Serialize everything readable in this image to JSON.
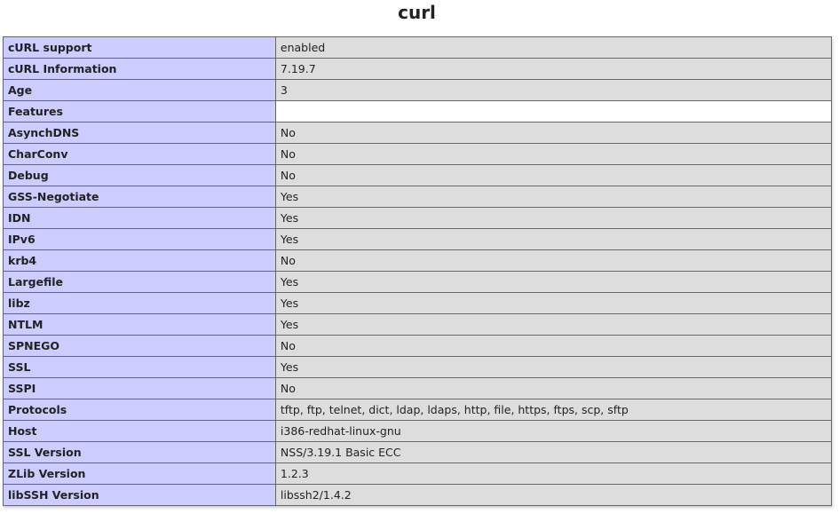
{
  "title": "curl",
  "rows": [
    {
      "key": "cURL support",
      "value": "enabled"
    },
    {
      "key": "cURL Information",
      "value": "7.19.7"
    },
    {
      "key": "Age",
      "value": "3"
    },
    {
      "key": "Features",
      "value": ""
    },
    {
      "key": "AsynchDNS",
      "value": "No"
    },
    {
      "key": "CharConv",
      "value": "No"
    },
    {
      "key": "Debug",
      "value": "No"
    },
    {
      "key": "GSS-Negotiate",
      "value": "Yes"
    },
    {
      "key": "IDN",
      "value": "Yes"
    },
    {
      "key": "IPv6",
      "value": "Yes"
    },
    {
      "key": "krb4",
      "value": "No"
    },
    {
      "key": "Largefile",
      "value": "Yes"
    },
    {
      "key": "libz",
      "value": "Yes"
    },
    {
      "key": "NTLM",
      "value": "Yes"
    },
    {
      "key": "SPNEGO",
      "value": "No"
    },
    {
      "key": "SSL",
      "value": "Yes"
    },
    {
      "key": "SSPI",
      "value": "No"
    },
    {
      "key": "Protocols",
      "value": "tftp, ftp, telnet, dict, ldap, ldaps, http, file, https, ftps, scp, sftp"
    },
    {
      "key": "Host",
      "value": "i386-redhat-linux-gnu"
    },
    {
      "key": "SSL Version",
      "value": "NSS/3.19.1 Basic ECC"
    },
    {
      "key": "ZLib Version",
      "value": "1.2.3"
    },
    {
      "key": "libSSH Version",
      "value": "libssh2/1.4.2"
    }
  ],
  "colors": {
    "key_background": "#ccccff",
    "value_background": "#dddddd",
    "border": "#666666",
    "text": "#222222"
  }
}
